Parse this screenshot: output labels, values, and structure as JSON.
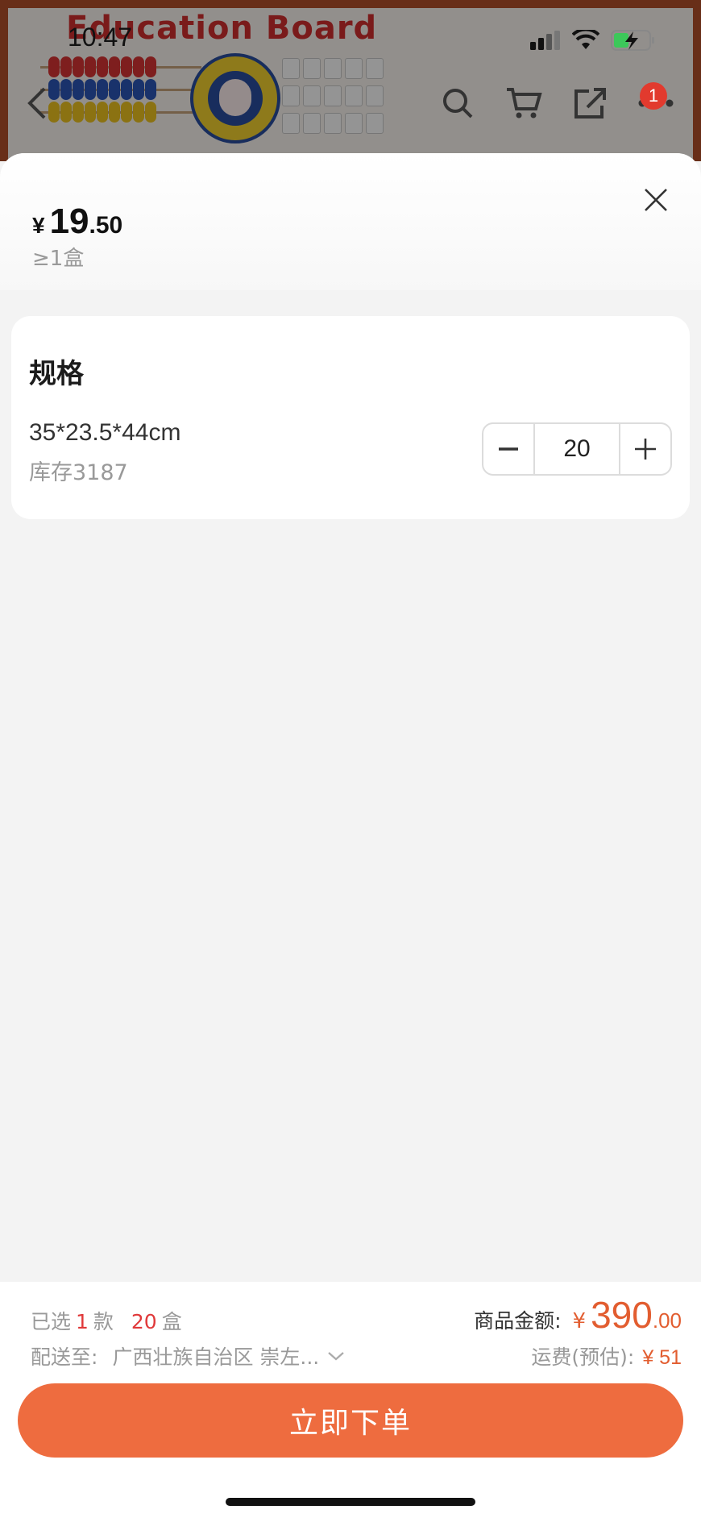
{
  "status_bar": {
    "time": "10:47"
  },
  "hero": {
    "board_title": "Education  Board",
    "notification_count": "1"
  },
  "sheet": {
    "price": {
      "symbol": "¥",
      "integer": "19",
      "decimal": ".50"
    },
    "min_order": "≥1盒",
    "spec": {
      "title": "规格",
      "option_name": "35*23.5*44cm",
      "stock": "库存3187",
      "quantity": "20"
    }
  },
  "footer": {
    "selected": {
      "prefix": "已选",
      "count": "1",
      "unit1": "款",
      "qty": "20",
      "unit2": "盒"
    },
    "ship": {
      "label": "配送至:",
      "address": "广西壮族自治区 崇左..."
    },
    "amount": {
      "label": "商品金额:",
      "symbol": "¥",
      "integer": "390",
      "decimal": ".00"
    },
    "freight": {
      "label": "运费(预估):",
      "value": "¥ 51"
    },
    "order_button": "立即下单"
  },
  "colors": {
    "accent": "#ee6c3f",
    "price_red": "#e25d30",
    "badge_red": "#e23a2e"
  }
}
